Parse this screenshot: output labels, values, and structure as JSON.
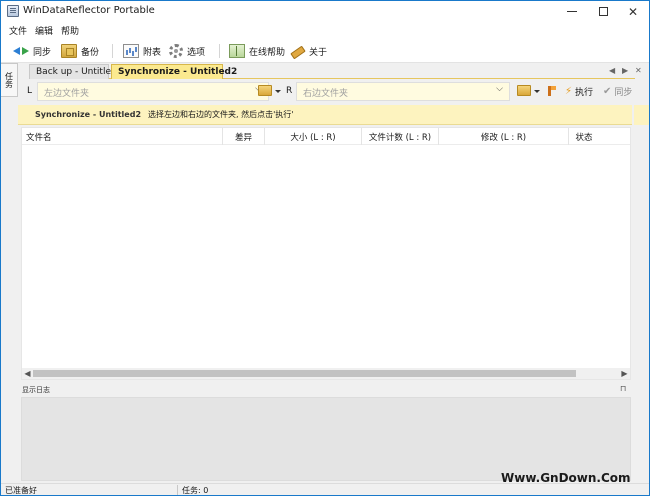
{
  "window": {
    "title": "WinDataReflector Portable"
  },
  "menu": [
    "文件",
    "编辑",
    "帮助"
  ],
  "toolbar": {
    "sync": "同步",
    "backup": "备份",
    "report": "附表",
    "options": "选项",
    "online_help": "在线帮助",
    "about": "关于"
  },
  "side_tab": "任务",
  "tabs": [
    {
      "label": "Back up - Untitled",
      "active": false
    },
    {
      "label": "Synchronize - Untitled2",
      "active": true
    }
  ],
  "folders": {
    "left_label": "L",
    "right_label": "R",
    "left_placeholder": "左边文件夹",
    "right_placeholder": "右边文件夹",
    "execute": "执行",
    "sync": "同步"
  },
  "info": {
    "title": "Synchronize - Untitled2",
    "message": "选择左边和右边的文件夹, 然后点击'执行'"
  },
  "table": {
    "columns": [
      "文件名",
      "差异",
      "大小 (L : R)",
      "文件计数 (L : R)",
      "修改 (L : R)",
      "状态"
    ]
  },
  "log": {
    "label": "显示日志"
  },
  "status": {
    "left": "已准备好",
    "tasks": "任务: 0"
  },
  "watermark": "Www.GnDown.Com",
  "colors": {
    "accent_border": "#1979ca",
    "active_tab": "#fbe98f",
    "info_bar": "#fdf3bf",
    "folder_input": "#fffbe0"
  }
}
